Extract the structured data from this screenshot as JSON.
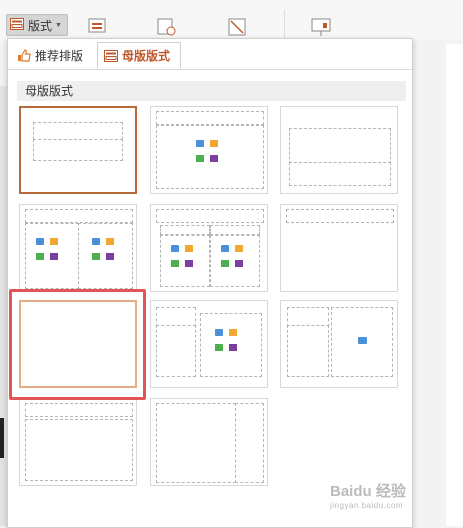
{
  "toolbar": {
    "layout_button_label": "版式"
  },
  "popup": {
    "tabs": [
      {
        "label": "推荐排版"
      },
      {
        "label": "母版版式"
      }
    ],
    "section_title": "母版版式",
    "layouts": [
      {
        "name": "title-slide"
      },
      {
        "name": "title-and-content"
      },
      {
        "name": "section-header"
      },
      {
        "name": "two-content"
      },
      {
        "name": "comparison"
      },
      {
        "name": "title-only"
      },
      {
        "name": "blank"
      },
      {
        "name": "content-with-caption"
      },
      {
        "name": "picture-with-caption"
      },
      {
        "name": "title-and-vertical-text"
      },
      {
        "name": "vertical-title-and-text"
      }
    ],
    "selected_layout": "title-slide",
    "highlighted_layout": "blank"
  },
  "watermark": {
    "text": "Baidu 经验",
    "subtext": "jingyan.baidu.com"
  }
}
